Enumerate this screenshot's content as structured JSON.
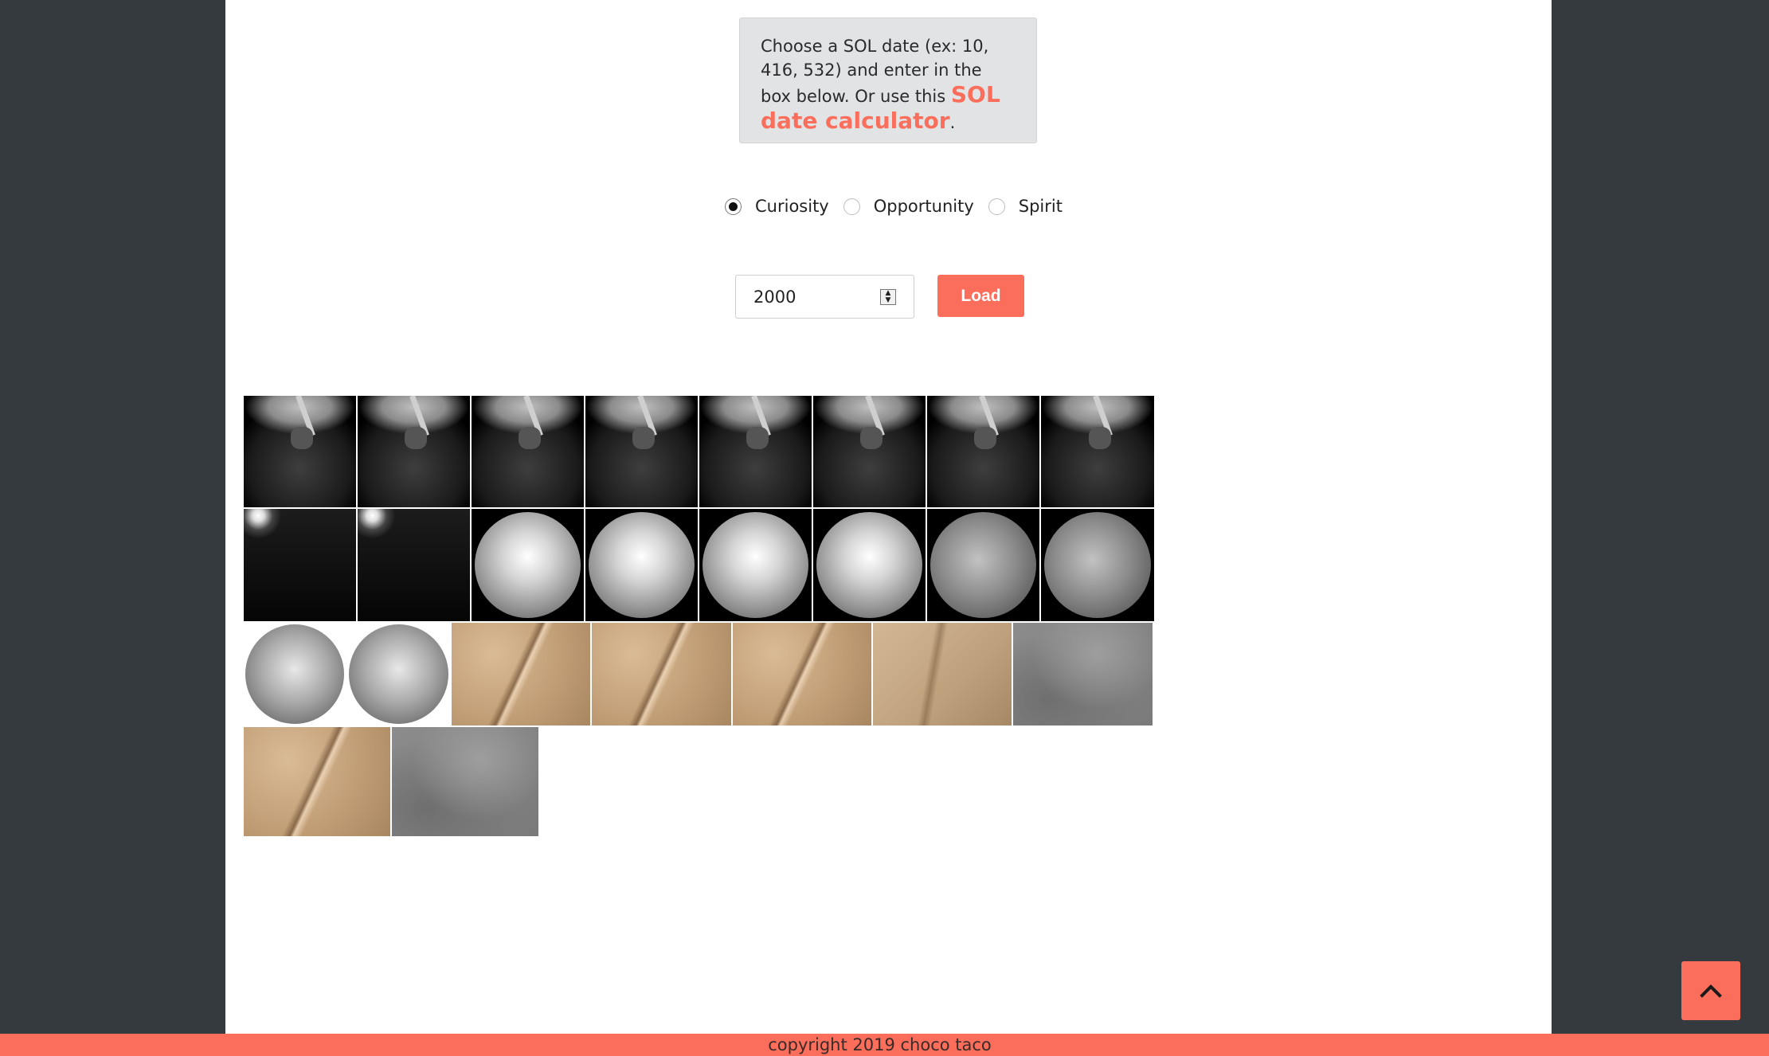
{
  "info": {
    "line1": "Choose a SOL date (ex: 10, 416, 532) and enter in the box below.",
    "line2_prefix": "Or use this",
    "link_label": "SOL date calculator",
    "line2_suffix": "."
  },
  "rovers": [
    {
      "label": "Curiosity",
      "selected": true
    },
    {
      "label": "Opportunity",
      "selected": false
    },
    {
      "label": "Spirit",
      "selected": false
    }
  ],
  "sol_input": {
    "value": "2000"
  },
  "load_button": {
    "label": "Load"
  },
  "footer": {
    "text": "copyright 2019 choco taco"
  },
  "icons": {
    "back_to_top": "chevron-up-icon",
    "spinner": "number-spinner-icon"
  },
  "colors": {
    "accent": "#fb6e5b",
    "sidebar": "#343a3d",
    "info_box": "#e2e3e5"
  },
  "gallery": {
    "rows": [
      [
        "nav",
        "nav",
        "nav",
        "nav",
        "nav",
        "nav",
        "nav",
        "nav"
      ],
      [
        "dark",
        "dark",
        "circ-bright",
        "circ-bright",
        "circ-bright",
        "circ-bright",
        "circ-grey",
        "circ-grey"
      ],
      [
        "circ-white",
        "circ-white",
        "rock",
        "rock",
        "rock",
        "rock2",
        "blur"
      ],
      [
        "rock",
        "blur"
      ]
    ]
  }
}
